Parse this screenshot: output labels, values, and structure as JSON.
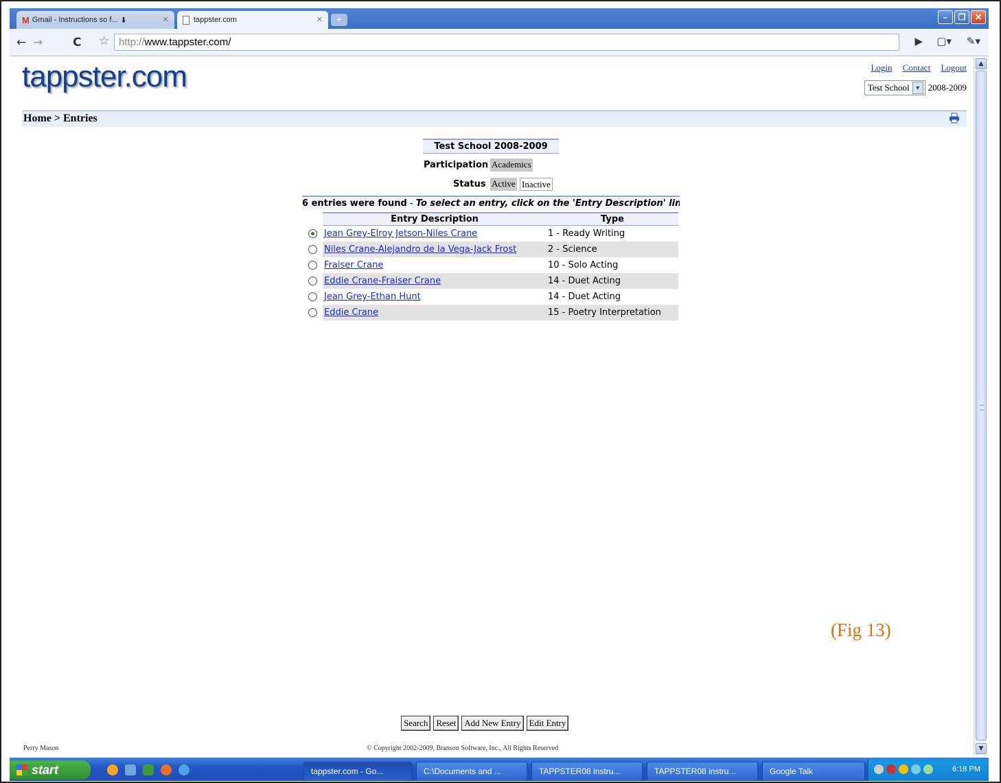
{
  "browser": {
    "tabs": [
      {
        "label": "Gmail - Instructions so f...",
        "active": false
      },
      {
        "label": "tappster.com",
        "active": true
      }
    ],
    "url_scheme": "http://",
    "url_host": "www.tappster.com/"
  },
  "site": {
    "logo": "tappster.com",
    "links": {
      "login": "Login",
      "contact": "Contact",
      "logout": "Logout"
    },
    "school_select": "Test School",
    "school_year": "2008-2009"
  },
  "breadcrumb": "Home > Entries",
  "summary": {
    "school_header": "Test School 2008-2009",
    "participation_label": "Participation",
    "participation_value": "Academics",
    "status_label": "Status",
    "status_active": "Active",
    "status_inactive": "Inactive",
    "found_text": "6 entries were found",
    "found_sep": " - ",
    "found_hint": "To select an entry, click on the 'Entry Description' link"
  },
  "table": {
    "columns": [
      "Entry Description",
      "Type"
    ],
    "rows": [
      {
        "desc": "Jean Grey-Elroy Jetson-Niles Crane",
        "type": "1 - Ready Writing",
        "selected": true
      },
      {
        "desc": "Niles Crane-Alejandro de la Vega-Jack Frost",
        "type": "2 - Science",
        "selected": false
      },
      {
        "desc": "Fraiser Crane",
        "type": "10 - Solo Acting",
        "selected": false
      },
      {
        "desc": "Eddie Crane-Fraiser Crane",
        "type": "14 - Duet Acting",
        "selected": false
      },
      {
        "desc": "Jean Grey-Ethan Hunt",
        "type": "14 - Duet Acting",
        "selected": false
      },
      {
        "desc": "Eddie Crane",
        "type": "15 - Poetry Interpretation",
        "selected": false
      }
    ]
  },
  "fig_label": "(Fig 13)",
  "buttons": {
    "search": "Search",
    "reset": "Reset",
    "add": "Add New Entry",
    "edit": "Edit Entry"
  },
  "footer": {
    "user": "Perry Mason",
    "copyright": "© Copyright 2002-2009, Branson Software, Inc., All Rights Reserved"
  },
  "taskbar": {
    "start": "start",
    "tasks": [
      "tappster.com - Go...",
      "C:\\Documents and ...",
      "TAPPSTER08 instru...",
      "TAPPSTER08 instru...",
      "Google Talk"
    ],
    "clock": "6:18 PM"
  },
  "colors": {
    "accent": "#9aa3cf",
    "link": "#1a2ad0",
    "fig": "#e46c0a"
  }
}
